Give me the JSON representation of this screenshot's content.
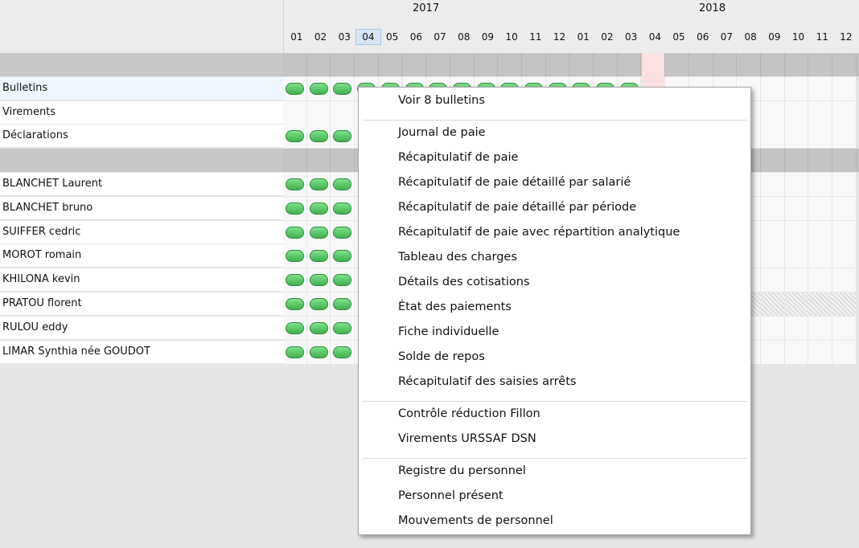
{
  "timeline": {
    "years": [
      "2017",
      "2018"
    ],
    "months": [
      "01",
      "02",
      "03",
      "04",
      "05",
      "06",
      "07",
      "08",
      "09",
      "10",
      "11",
      "12",
      "01",
      "02",
      "03",
      "04",
      "05",
      "06",
      "07",
      "08",
      "09",
      "10",
      "11",
      "12"
    ]
  },
  "rows": [
    {
      "label": "",
      "separator": true
    },
    {
      "label": "Bulletins",
      "pills": 15
    },
    {
      "label": "Virements",
      "pills": 0
    },
    {
      "label": "Déclarations",
      "pills": 3
    },
    {
      "label": "",
      "separator": true
    },
    {
      "label": "BLANCHET Laurent",
      "pills": 3
    },
    {
      "label": "BLANCHET bruno",
      "pills": 3
    },
    {
      "label": "SUIFFER cedric",
      "pills": 3
    },
    {
      "label": "MOROT romain",
      "pills": 3
    },
    {
      "label": "KHILONA kevin",
      "pills": 3
    },
    {
      "label": "PRATOU florent",
      "pills": 3
    },
    {
      "label": "RULOU eddy",
      "pills": 3
    },
    {
      "label": "LIMAR Synthia née GOUDOT",
      "pills": 3
    }
  ],
  "context_menu": {
    "groups": [
      [
        "Voir 8 bulletins"
      ],
      [
        "Journal de paie",
        "Récapitulatif de paie",
        "Récapitulatif de paie détaillé par salarié",
        "Récapitulatif de paie détaillé par période",
        "Récapitulatif de paie avec répartition analytique",
        "Tableau des charges",
        "Détails des cotisations",
        "État des paiements",
        "Fiche individuelle",
        "Solde de repos",
        "Récapitulatif des saisies arrêts"
      ],
      [
        "Contrôle réduction Fillon",
        "Virements URSSAF DSN"
      ],
      [
        "Registre du personnel",
        "Personnel présent",
        "Mouvements de personnel"
      ]
    ]
  },
  "colors": {
    "pill": "#4cc45c",
    "highlight_month": "#fbe1e1",
    "separator": "#c4c4c4"
  }
}
